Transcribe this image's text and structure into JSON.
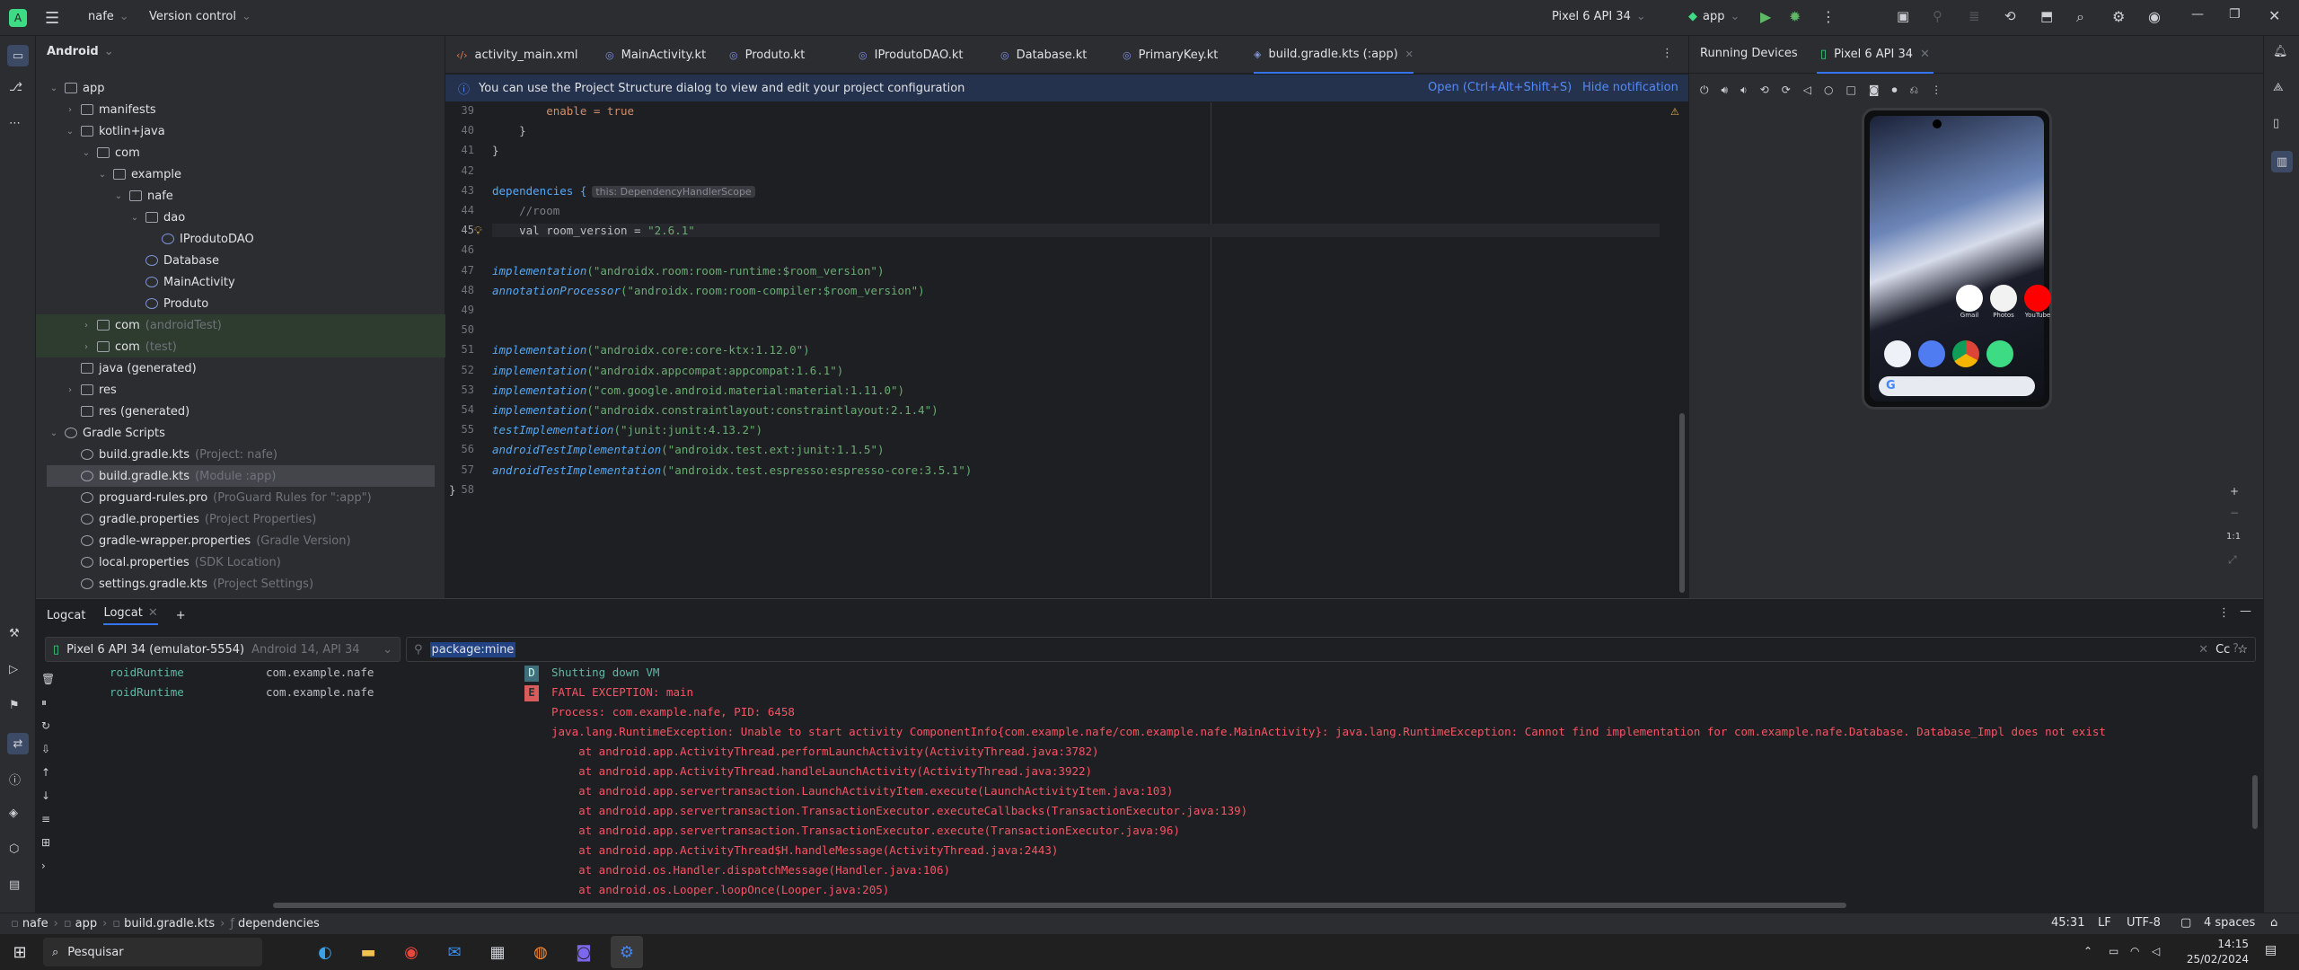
{
  "titlebar": {
    "project": "nafe",
    "vcs": "Version control",
    "device": "Pixel 6 API 34",
    "run_config": "app"
  },
  "project_panel": {
    "view": "Android",
    "items": [
      {
        "label": "app",
        "extra": ""
      },
      {
        "label": "manifests",
        "extra": ""
      },
      {
        "label": "kotlin+java",
        "extra": ""
      },
      {
        "label": "com",
        "extra": ""
      },
      {
        "label": "example",
        "extra": ""
      },
      {
        "label": "nafe",
        "extra": ""
      },
      {
        "label": "dao",
        "extra": ""
      },
      {
        "label": "IProdutoDAO",
        "extra": ""
      },
      {
        "label": "Database",
        "extra": ""
      },
      {
        "label": "MainActivity",
        "extra": ""
      },
      {
        "label": "Produto",
        "extra": ""
      },
      {
        "label": "com",
        "extra": "(androidTest)"
      },
      {
        "label": "com",
        "extra": "(test)"
      },
      {
        "label": "java (generated)",
        "extra": ""
      },
      {
        "label": "res",
        "extra": ""
      },
      {
        "label": "res (generated)",
        "extra": ""
      },
      {
        "label": "Gradle Scripts",
        "extra": ""
      },
      {
        "label": "build.gradle.kts",
        "extra": "(Project: nafe)"
      },
      {
        "label": "build.gradle.kts",
        "extra": "(Module :app)"
      },
      {
        "label": "proguard-rules.pro",
        "extra": "(ProGuard Rules for \":app\")"
      },
      {
        "label": "gradle.properties",
        "extra": "(Project Properties)"
      },
      {
        "label": "gradle-wrapper.properties",
        "extra": "(Gradle Version)"
      },
      {
        "label": "local.properties",
        "extra": "(SDK Location)"
      },
      {
        "label": "settings.gradle.kts",
        "extra": "(Project Settings)"
      }
    ]
  },
  "tabs": [
    "activity_main.xml",
    "MainActivity.kt",
    "Produto.kt",
    "IProdutoDAO.kt",
    "Database.kt",
    "PrimaryKey.kt",
    "build.gradle.kts (:app)"
  ],
  "notification": {
    "text": "You can use the Project Structure dialog to view and edit your project configuration",
    "open": "Open (Ctrl+Alt+Shift+S)",
    "hide": "Hide notification"
  },
  "code": {
    "line_numbers": [
      "39",
      "40",
      "41",
      "42",
      "43",
      "44",
      "45",
      "46",
      "47",
      "48",
      "49",
      "50",
      "51",
      "52",
      "53",
      "54",
      "55",
      "56",
      "57",
      "58"
    ],
    "l39": "        enable = true",
    "l40": "    }",
    "l41": "}",
    "l43a": "dependencies {",
    "l43hint": "this: DependencyHandlerScope",
    "l44": "    //room",
    "l45a": "    val room_version = ",
    "l45b": "\"2.6.1\"",
    "deps": [
      {
        "fn": "implementation",
        "arg": "(\"androidx.room:room-runtime:$room_version\")"
      },
      {
        "fn": "annotationProcessor",
        "arg": "(\"androidx.room:room-compiler:$room_version\")"
      },
      {
        "fn": "implementation",
        "arg": "(\"androidx.core:core-ktx:1.12.0\")"
      },
      {
        "fn": "implementation",
        "arg": "(\"androidx.appcompat:appcompat:1.6.1\")"
      },
      {
        "fn": "implementation",
        "arg": "(\"com.google.android.material:material:1.11.0\")"
      },
      {
        "fn": "implementation",
        "arg": "(\"androidx.constraintlayout:constraintlayout:2.1.4\")"
      },
      {
        "fn": "testImplementation",
        "arg": "(\"junit:junit:4.13.2\")"
      },
      {
        "fn": "androidTestImplementation",
        "arg": "(\"androidx.test.ext:junit:1.1.5\")"
      },
      {
        "fn": "androidTestImplementation",
        "arg": "(\"androidx.test.espresso:espresso-core:3.5.1\")"
      }
    ],
    "l58": "}"
  },
  "devices": {
    "title": "Running Devices",
    "tab": "Pixel 6 API 34",
    "zoom": "1:1",
    "apps": [
      "Gmail",
      "Photos",
      "YouTube"
    ]
  },
  "logcat": {
    "tab1": "Logcat",
    "tab2": "Logcat",
    "device": "Pixel 6 API 34 (emulator-5554)",
    "device_extra": "Android 14, API 34",
    "filter": "package:mine",
    "lines": [
      {
        "tag": "roidRuntime",
        "pkg": "com.example.nafe",
        "level": "D",
        "msg": "Shutting down VM"
      },
      {
        "tag": "roidRuntime",
        "pkg": "com.example.nafe",
        "level": "E",
        "msg": "FATAL EXCEPTION: main"
      }
    ],
    "trace": [
      "Process: com.example.nafe, PID: 6458",
      "java.lang.RuntimeException: Unable to start activity ComponentInfo{com.example.nafe/com.example.nafe.MainActivity}: java.lang.RuntimeException: Cannot find implementation for com.example.nafe.Database. Database_Impl does not exist",
      "    at android.app.ActivityThread.performLaunchActivity(ActivityThread.java:3782)",
      "    at android.app.ActivityThread.handleLaunchActivity(ActivityThread.java:3922)",
      "    at android.app.servertransaction.LaunchActivityItem.execute(LaunchActivityItem.java:103)",
      "    at android.app.servertransaction.TransactionExecutor.executeCallbacks(TransactionExecutor.java:139)",
      "    at android.app.servertransaction.TransactionExecutor.execute(TransactionExecutor.java:96)",
      "    at android.app.ActivityThread$H.handleMessage(ActivityThread.java:2443)",
      "    at android.os.Handler.dispatchMessage(Handler.java:106)",
      "    at android.os.Looper.loopOnce(Looper.java:205)"
    ]
  },
  "statusbar": {
    "crumbs": [
      "nafe",
      "app",
      "build.gradle.kts",
      "dependencies"
    ],
    "position": "45:31",
    "line_sep": "LF",
    "encoding": "UTF-8",
    "indent": "4 spaces"
  },
  "taskbar": {
    "search": "Pesquisar",
    "time": "14:15",
    "date": "25/02/2024"
  }
}
